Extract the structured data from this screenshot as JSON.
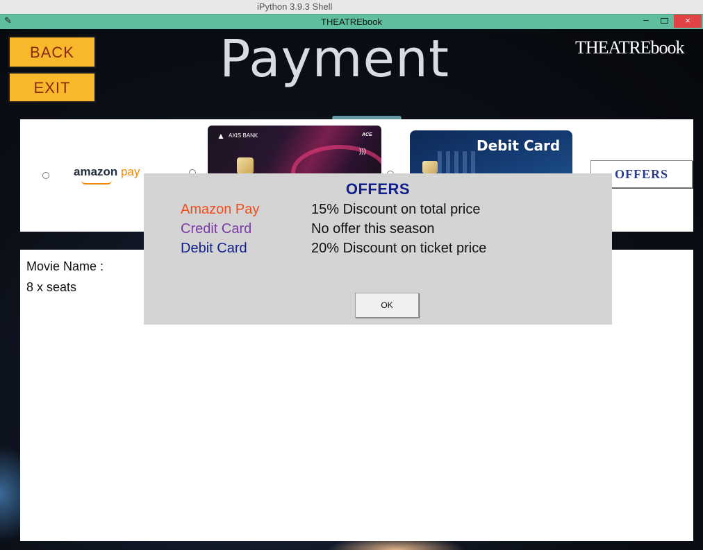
{
  "background_window": {
    "title": "iPython 3.9.3 Shell"
  },
  "window": {
    "title": "THEATREbook",
    "min_glyph": "–",
    "close_glyph": "×"
  },
  "header": {
    "back_label": "BACK",
    "exit_label": "EXIT",
    "heading": "Payment",
    "brand": "THEATREbook"
  },
  "payment_options": {
    "amazon": {
      "word": "amazon",
      "suffix": "pay"
    },
    "credit_card": {
      "bank": "AXIS BANK",
      "variant": "ACE"
    },
    "debit_card": {
      "title": "Debit Card"
    },
    "offers_button": "OFFERS"
  },
  "details": {
    "movie_name_label": "Movie Name :",
    "seats_text": "8 x seats"
  },
  "offers_dialog": {
    "title": "OFFERS",
    "rows": [
      {
        "label": "Amazon Pay",
        "value": "15% Discount on total price"
      },
      {
        "label": "Credit Card",
        "value": "No offer this season"
      },
      {
        "label": "Debit Card",
        "value": "20% Discount on ticket price"
      }
    ],
    "ok_label": "OK"
  },
  "colors": {
    "titlebar": "#5fbea0",
    "button_orange": "#f7b82c",
    "button_text": "#8a2b10",
    "dialog_bg": "#d4d4d4",
    "dialog_title": "#10208a",
    "amazon_label": "#f04d1e",
    "credit_label": "#7a3aa6",
    "debit_label": "#10208a"
  }
}
